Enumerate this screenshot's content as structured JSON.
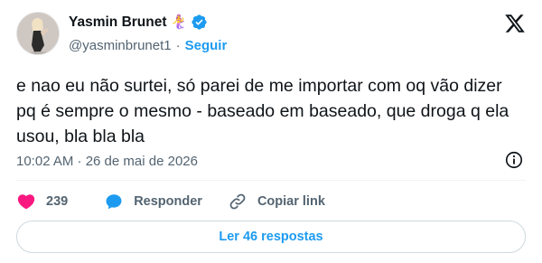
{
  "author": {
    "display_name": "Yasmin Brunet",
    "emoji": "🧜‍♀️",
    "handle": "@yasminbrunet1",
    "separator": "·",
    "follow_label": "Seguir"
  },
  "tweet": {
    "text": "e nao eu não surtei, só parei de me importar com oq vão dizer pq é sempre o mesmo - baseado em baseado, que droga q ela usou, bla bla bla",
    "timestamp": "10:02 AM · 26 de mai de 2026"
  },
  "actions": {
    "like_count": "239",
    "reply_label": "Responder",
    "copy_link_label": "Copiar link"
  },
  "replies_button_label": "Ler 46 respostas",
  "colors": {
    "accent": "#1d9bf0",
    "like": "#f91880",
    "text": "#0f1419",
    "muted": "#536471"
  },
  "icons": [
    "verified-badge-icon",
    "x-logo-icon",
    "info-icon",
    "heart-icon",
    "reply-bubble-icon",
    "link-icon"
  ]
}
